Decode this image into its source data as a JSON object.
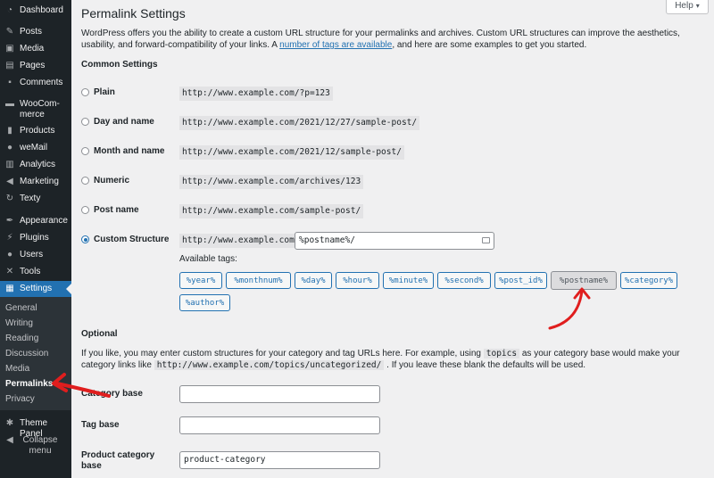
{
  "sidebar": {
    "items": [
      {
        "label": "Dashboard",
        "icon": "dashboard-icon",
        "glyph": "◔"
      },
      {
        "label": "Posts",
        "icon": "pin-icon",
        "glyph": "✎"
      },
      {
        "label": "Media",
        "icon": "media-icon",
        "glyph": "▣"
      },
      {
        "label": "Pages",
        "icon": "pages-icon",
        "glyph": "▤"
      },
      {
        "label": "Comments",
        "icon": "comments-icon",
        "glyph": "▪"
      },
      {
        "label": "WooCom-",
        "label2": "merce",
        "icon": "woocommerce-icon",
        "glyph": "▬"
      },
      {
        "label": "Products",
        "icon": "products-icon",
        "glyph": "▮"
      },
      {
        "label": "weMail",
        "icon": "wemail-icon",
        "glyph": "●"
      },
      {
        "label": "Analytics",
        "icon": "analytics-icon",
        "glyph": "▥"
      },
      {
        "label": "Marketing",
        "icon": "megaphone-icon",
        "glyph": "◀"
      },
      {
        "label": "Texty",
        "icon": "texty-icon",
        "glyph": "↻"
      },
      {
        "label": "Appearance",
        "icon": "brush-icon",
        "glyph": "✒"
      },
      {
        "label": "Plugins",
        "icon": "plugin-icon",
        "glyph": "⚡"
      },
      {
        "label": "Users",
        "icon": "users-icon",
        "glyph": "●"
      },
      {
        "label": "Tools",
        "icon": "wrench-icon",
        "glyph": "✕"
      },
      {
        "label": "Settings",
        "icon": "settings-icon",
        "glyph": "▦"
      }
    ],
    "submenu": [
      "General",
      "Writing",
      "Reading",
      "Discussion",
      "Media",
      "Permalinks",
      "Privacy"
    ],
    "theme_panel": {
      "label": "Theme Panel",
      "glyph": "✱"
    },
    "collapse": {
      "label": "Collapse",
      "label2": "menu",
      "glyph": "◀"
    }
  },
  "help": {
    "label": "Help",
    "arrow": "▾"
  },
  "page": {
    "title": "Permalink Settings",
    "intro_before": "WordPress offers you the ability to create a custom URL structure for your permalinks and archives. Custom URL structures can improve the aesthetics, usability, and forward-compatibility of your links. A ",
    "intro_link": "number of tags are available",
    "intro_after": ", and here are some examples to get you started."
  },
  "common": {
    "heading": "Common Settings",
    "options": [
      {
        "label": "Plain",
        "example": "http://www.example.com/?p=123",
        "checked": false
      },
      {
        "label": "Day and name",
        "example": "http://www.example.com/2021/12/27/sample-post/",
        "checked": false
      },
      {
        "label": "Month and name",
        "example": "http://www.example.com/2021/12/sample-post/",
        "checked": false
      },
      {
        "label": "Numeric",
        "example": "http://www.example.com/archives/123",
        "checked": false
      },
      {
        "label": "Post name",
        "example": "http://www.example.com/sample-post/",
        "checked": false
      },
      {
        "label": "Custom Structure",
        "example": "http://www.example.com",
        "checked": true
      }
    ],
    "custom_value": "%postname%/",
    "available_tags_label": "Available tags:",
    "tags": [
      "%year%",
      "%monthnum%",
      "%day%",
      "%hour%",
      "%minute%",
      "%second%",
      "%post_id%",
      "%postname%",
      "%category%",
      "%author%"
    ],
    "selected_tag": "%postname%"
  },
  "optional": {
    "heading": "Optional",
    "desc_1": "If you like, you may enter custom structures for your category and tag URLs here. For example, using ",
    "desc_code1": "topics",
    "desc_2": " as your category base would make your category links like ",
    "desc_code2": "http://www.example.com/topics/uncategorized/",
    "desc_3": " . If you leave these blank the defaults will be used.",
    "category_base_label": "Category base",
    "category_base_value": "",
    "tag_base_label": "Tag base",
    "tag_base_value": "",
    "product_category_base_label_1": "Product category",
    "product_category_base_label_2": "base",
    "product_category_base_value": "product-category"
  },
  "colors": {
    "accent": "#2271b1",
    "annotation": "#e01e1e",
    "sidebar": "#1d2327"
  }
}
